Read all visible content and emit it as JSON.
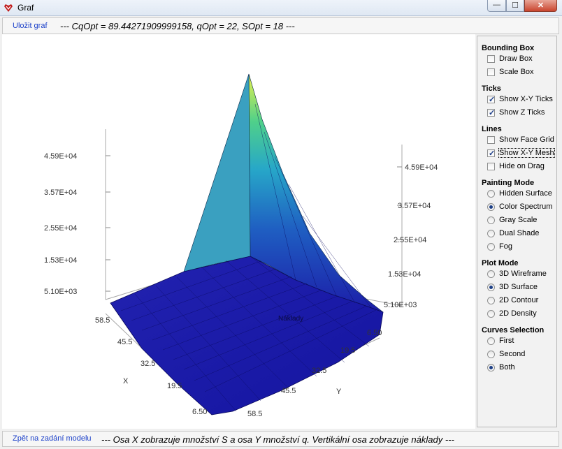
{
  "window": {
    "title": "Graf",
    "min_label": "—",
    "max_label": "☐",
    "close_label": "✕"
  },
  "top": {
    "save_link": "Uložit graf",
    "info": "--- CqOpt = 89.44271909999158, qOpt = 22, SOpt = 18 ---"
  },
  "bottom": {
    "back_link": "Zpět na zadání modelu",
    "info": "--- Osa X zobrazuje množství S a osa Y množství q. Vertikální osa zobrazuje náklady ---"
  },
  "panel": {
    "bounding_box": {
      "title": "Bounding Box",
      "draw_box": {
        "label": "Draw Box",
        "checked": false
      },
      "scale_box": {
        "label": "Scale Box",
        "checked": false
      }
    },
    "ticks": {
      "title": "Ticks",
      "xy": {
        "label": "Show X-Y Ticks",
        "checked": true
      },
      "z": {
        "label": "Show Z Ticks",
        "checked": true
      }
    },
    "lines": {
      "title": "Lines",
      "face_grid": {
        "label": "Show Face Grid",
        "checked": false
      },
      "xy_mesh": {
        "label": "Show X-Y Mesh",
        "checked": true
      },
      "hide_drag": {
        "label": "Hide on Drag",
        "checked": false
      }
    },
    "painting": {
      "title": "Painting Mode",
      "hidden": "Hidden Surface",
      "spectrum": "Color Spectrum",
      "gray": "Gray Scale",
      "dual": "Dual Shade",
      "fog": "Fog",
      "selected": "Color Spectrum"
    },
    "plot_mode": {
      "title": "Plot Mode",
      "wire": "3D Wireframe",
      "surface": "3D Surface",
      "contour": "2D Contour",
      "density": "2D Density",
      "selected": "3D Surface"
    },
    "curves": {
      "title": "Curves Selection",
      "first": "First",
      "second": "Second",
      "both": "Both",
      "selected": "Both"
    }
  },
  "plot": {
    "z_ticks": [
      "4.59E+04",
      "3.57E+04",
      "2.55E+04",
      "1.53E+04",
      "5.10E+03"
    ],
    "x_ticks": [
      "58.5",
      "45.5",
      "32.5",
      "19.5",
      "6.50"
    ],
    "y_ticks": [
      "6.50",
      "19.5",
      "32.5",
      "45.5",
      "58.5"
    ],
    "x_label": "X",
    "y_label": "Y",
    "surface_label": "Náklady"
  },
  "colors": {
    "surface_low": "#1818b0",
    "surface_mid": "#2a9ad0",
    "surface_high": "#e6f24a",
    "link": "#1a3fc9"
  }
}
